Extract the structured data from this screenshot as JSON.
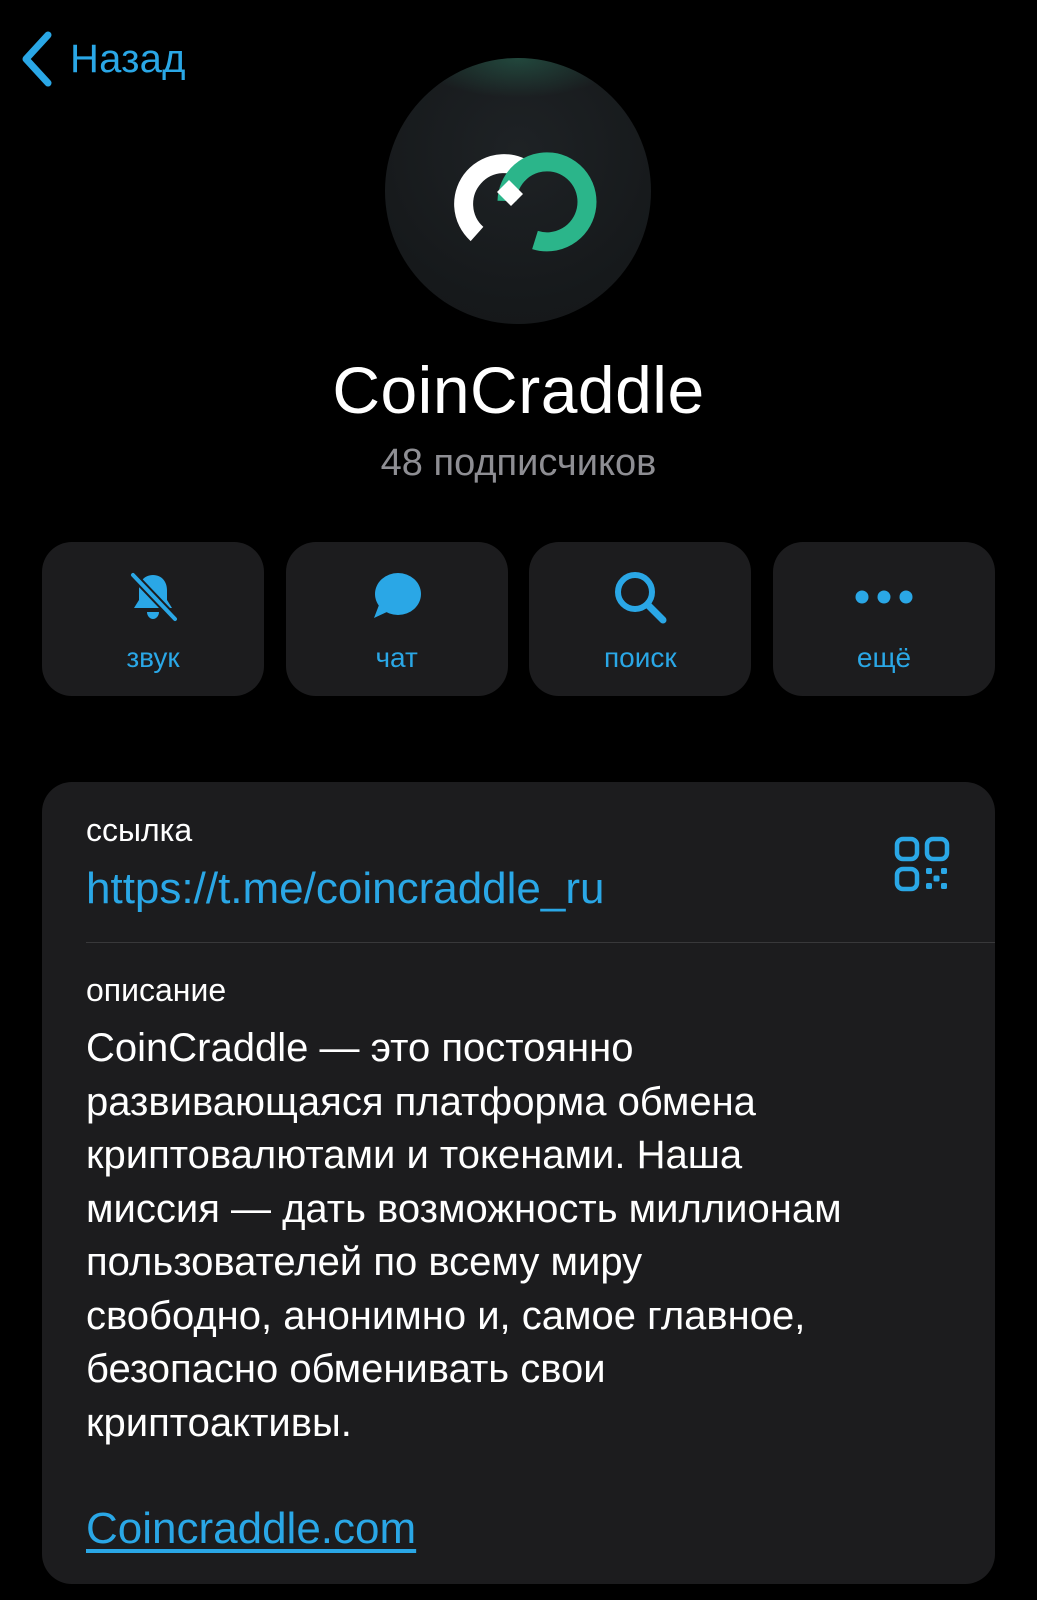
{
  "nav": {
    "back_label": "Назад",
    "back_icon": "chevron-left-icon",
    "accent_color": "#2aa7e6"
  },
  "channel": {
    "name": "CoinCraddle",
    "subscribers": "48 подписчиков",
    "avatar_icon": "coincraddle-logo-icon",
    "logo_colors": {
      "white": "#ffffff",
      "green": "#2bb58a"
    }
  },
  "actions": [
    {
      "label": "звук",
      "icon": "bell-muted-icon"
    },
    {
      "label": "чат",
      "icon": "chat-bubble-icon"
    },
    {
      "label": "поиск",
      "icon": "search-icon"
    },
    {
      "label": "ещё",
      "icon": "more-dots-icon"
    }
  ],
  "info": {
    "link_label": "ссылка",
    "link_value": "https://t.me/coincraddle_ru",
    "qr_icon": "qr-code-icon",
    "description_label": "описание",
    "description_lines": [
      "CoinCraddle — это постоянно",
      "развивающаяся платформа обмена",
      "криптовалютами и токенами. Наша",
      "миссия — дать возможность миллионам",
      "пользователей по всему миру",
      "свободно, анонимно и, самое главное,",
      "безопасно обменивать свои",
      "криптоактивы."
    ],
    "website": "Coincraddle.com"
  }
}
